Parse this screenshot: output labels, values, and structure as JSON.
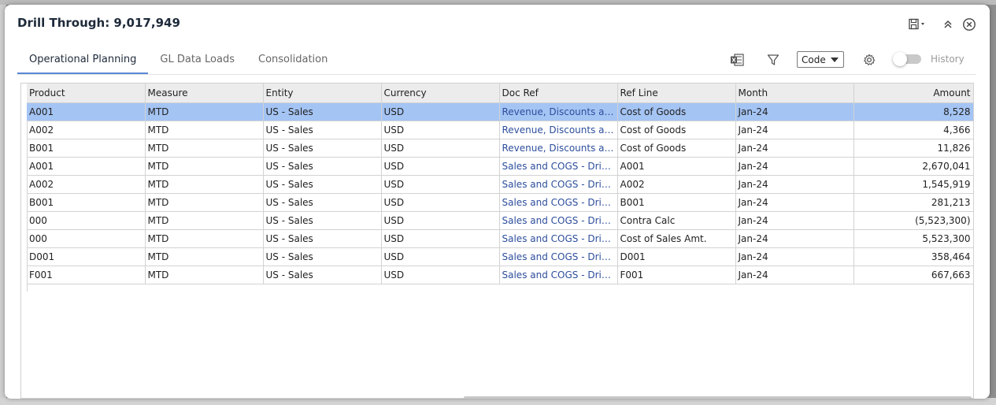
{
  "dialog": {
    "title": "Drill Through: 9,017,949"
  },
  "tabs": [
    {
      "label": "Operational Planning",
      "active": true
    },
    {
      "label": "GL Data Loads",
      "active": false
    },
    {
      "label": "Consolidation",
      "active": false
    }
  ],
  "toolbar": {
    "view_select": "Code",
    "history_label": "History",
    "history_on": false
  },
  "grid": {
    "columns": [
      "Product",
      "Measure",
      "Entity",
      "Currency",
      "Doc Ref",
      "Ref Line",
      "Month",
      "Amount"
    ],
    "rows": [
      [
        "A001",
        "MTD",
        "US - Sales",
        "USD",
        "Revenue, Discounts an...",
        "Cost of Goods",
        "Jan-24",
        "8,528"
      ],
      [
        "A002",
        "MTD",
        "US - Sales",
        "USD",
        "Revenue, Discounts an...",
        "Cost of Goods",
        "Jan-24",
        "4,366"
      ],
      [
        "B001",
        "MTD",
        "US - Sales",
        "USD",
        "Revenue, Discounts an...",
        "Cost of Goods",
        "Jan-24",
        "11,826"
      ],
      [
        "A001",
        "MTD",
        "US - Sales",
        "USD",
        "Sales and COGS - Drive...",
        "A001",
        "Jan-24",
        "2,670,041"
      ],
      [
        "A002",
        "MTD",
        "US - Sales",
        "USD",
        "Sales and COGS - Drive...",
        "A002",
        "Jan-24",
        "1,545,919"
      ],
      [
        "B001",
        "MTD",
        "US - Sales",
        "USD",
        "Sales and COGS - Drive...",
        "B001",
        "Jan-24",
        "281,213"
      ],
      [
        "000",
        "MTD",
        "US - Sales",
        "USD",
        "Sales and COGS - Drive...",
        "Contra Calc",
        "Jan-24",
        "(5,523,300)"
      ],
      [
        "000",
        "MTD",
        "US - Sales",
        "USD",
        "Sales and COGS - Drive...",
        "Cost of Sales Amt.",
        "Jan-24",
        "5,523,300"
      ],
      [
        "D001",
        "MTD",
        "US - Sales",
        "USD",
        "Sales and COGS - Drive...",
        "D001",
        "Jan-24",
        "358,464"
      ],
      [
        "F001",
        "MTD",
        "US - Sales",
        "USD",
        "Sales and COGS - Drive...",
        "F001",
        "Jan-24",
        "667,663"
      ]
    ],
    "selected_row": 0
  },
  "colors": {
    "selected_row": "#a4c4f4",
    "link_text": "#2d4e9c",
    "active_tab_underline": "#5b88d6"
  }
}
